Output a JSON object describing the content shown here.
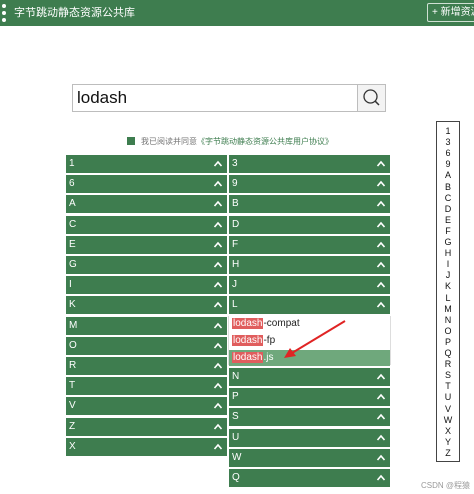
{
  "header": {
    "title": "字节跳动静态资源公共库",
    "add_button": "+ 新增资源"
  },
  "search": {
    "value": "lodash",
    "button_icon": "search-icon"
  },
  "agreement": {
    "text": "我已阅读并同意",
    "link": "《字节跳动静态资源公共库用户协议》"
  },
  "index_letters": [
    "1",
    "3",
    "6",
    "9",
    "A",
    "B",
    "C",
    "D",
    "E",
    "F",
    "G",
    "H",
    "I",
    "J",
    "K",
    "L",
    "M",
    "N",
    "O",
    "P",
    "Q",
    "R",
    "S",
    "T",
    "U",
    "V",
    "W",
    "X",
    "Y",
    "Z"
  ],
  "left_column": [
    "1",
    "6",
    "A",
    "C",
    "E",
    "G",
    "I",
    "K",
    "M",
    "O",
    "R",
    "T",
    "V",
    "Z",
    "X"
  ],
  "right_column_top": [
    "3",
    "9",
    "B",
    "D",
    "F",
    "H",
    "J",
    "L"
  ],
  "right_column_bottom": [
    "N",
    "P",
    "S",
    "U",
    "W",
    "Q"
  ],
  "dropdown": {
    "items": [
      {
        "match": "lodash",
        "rest": "-compat"
      },
      {
        "match": "lodash",
        "rest": "-fp"
      },
      {
        "match": "lodash",
        "rest": ".js"
      }
    ],
    "selected_index": 2
  },
  "colors": {
    "primary": "#3e7d4f",
    "selected": "#6fa87c",
    "highlight": "#e05d5d",
    "arrow": "#e02424"
  },
  "watermark": "CSDN @程猿"
}
